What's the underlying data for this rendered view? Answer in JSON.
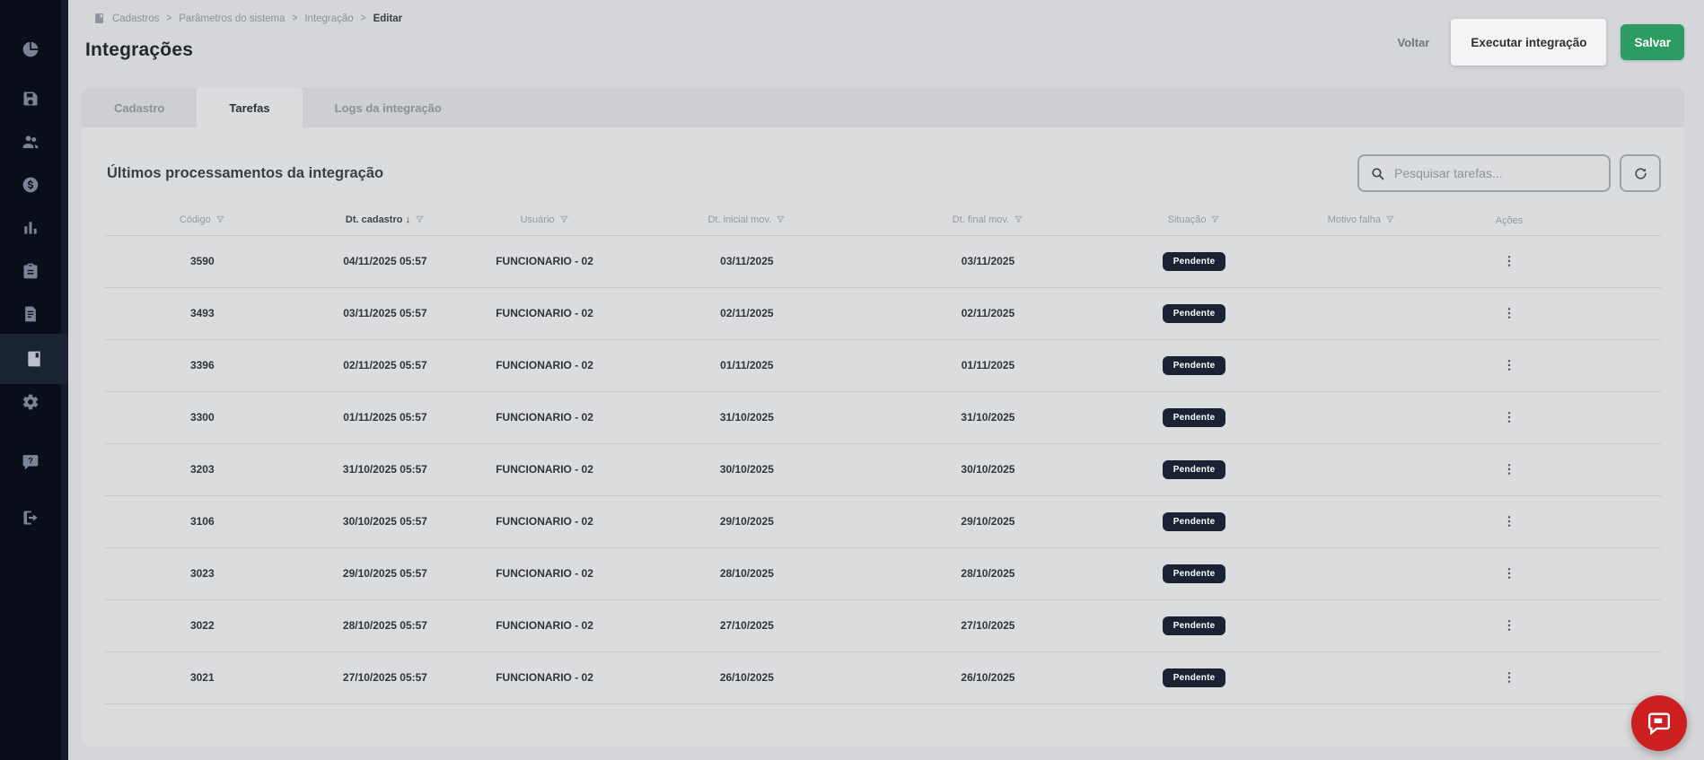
{
  "colors": {
    "sidebar_bg": "#0a0e18",
    "sidebar_active_bg": "#1a2334",
    "page_bg": "#d5d6d9",
    "strip_bg": "#cdcfd3",
    "card_bg": "#dbdcdd",
    "badge_bg": "#1b2233",
    "save_green": "#2c9c62",
    "fab_red": "#cc1f1f"
  },
  "sidebar": {
    "items": [
      {
        "icon": "pie-chart-icon",
        "active": false
      },
      {
        "icon": "save-icon",
        "active": false
      },
      {
        "icon": "users-icon",
        "active": false
      },
      {
        "icon": "dollar-icon",
        "active": false
      },
      {
        "icon": "bar-chart-icon",
        "active": false
      },
      {
        "icon": "clipboard-icon",
        "active": false
      },
      {
        "icon": "document-icon",
        "active": false
      },
      {
        "icon": "book-icon",
        "active": true
      },
      {
        "icon": "gear-icon",
        "active": false
      },
      {
        "icon": "help-icon",
        "active": false
      },
      {
        "icon": "logout-icon",
        "active": false
      }
    ]
  },
  "breadcrumb": {
    "items": [
      "Cadastros",
      "Parâmetros do sistema",
      "Integração",
      "Editar"
    ]
  },
  "header": {
    "title": "Integrações",
    "back_label": "Voltar",
    "run_label": "Executar integração",
    "save_label": "Salvar"
  },
  "tabs": [
    {
      "label": "Cadastro",
      "active": false
    },
    {
      "label": "Tarefas",
      "active": true
    },
    {
      "label": "Logs da integração",
      "active": false
    }
  ],
  "panel": {
    "title": "Últimos processamentos da integração",
    "search_placeholder": "Pesquisar tarefas..."
  },
  "table": {
    "columns": [
      {
        "label": "Código",
        "filter": true,
        "sorted": ""
      },
      {
        "label": "Dt. cadastro",
        "filter": true,
        "sorted": "desc"
      },
      {
        "label": "Usuário",
        "filter": true,
        "sorted": ""
      },
      {
        "label": "Dt. inicial mov.",
        "filter": true,
        "sorted": ""
      },
      {
        "label": "Dt. final mov.",
        "filter": true,
        "sorted": ""
      },
      {
        "label": "Situação",
        "filter": true,
        "sorted": ""
      },
      {
        "label": "Motivo falha",
        "filter": true,
        "sorted": ""
      },
      {
        "label": "Ações",
        "filter": false,
        "sorted": ""
      }
    ],
    "rows": [
      {
        "codigo": "3590",
        "dt_cadastro": "04/11/2025 05:57",
        "usuario": "FUNCIONARIO - 02",
        "dt_inicial_mov": "03/11/2025",
        "dt_final_mov": "03/11/2025",
        "situacao": "Pendente",
        "motivo_falha": ""
      },
      {
        "codigo": "3493",
        "dt_cadastro": "03/11/2025 05:57",
        "usuario": "FUNCIONARIO - 02",
        "dt_inicial_mov": "02/11/2025",
        "dt_final_mov": "02/11/2025",
        "situacao": "Pendente",
        "motivo_falha": ""
      },
      {
        "codigo": "3396",
        "dt_cadastro": "02/11/2025 05:57",
        "usuario": "FUNCIONARIO - 02",
        "dt_inicial_mov": "01/11/2025",
        "dt_final_mov": "01/11/2025",
        "situacao": "Pendente",
        "motivo_falha": ""
      },
      {
        "codigo": "3300",
        "dt_cadastro": "01/11/2025 05:57",
        "usuario": "FUNCIONARIO - 02",
        "dt_inicial_mov": "31/10/2025",
        "dt_final_mov": "31/10/2025",
        "situacao": "Pendente",
        "motivo_falha": ""
      },
      {
        "codigo": "3203",
        "dt_cadastro": "31/10/2025 05:57",
        "usuario": "FUNCIONARIO - 02",
        "dt_inicial_mov": "30/10/2025",
        "dt_final_mov": "30/10/2025",
        "situacao": "Pendente",
        "motivo_falha": ""
      },
      {
        "codigo": "3106",
        "dt_cadastro": "30/10/2025 05:57",
        "usuario": "FUNCIONARIO - 02",
        "dt_inicial_mov": "29/10/2025",
        "dt_final_mov": "29/10/2025",
        "situacao": "Pendente",
        "motivo_falha": ""
      },
      {
        "codigo": "3023",
        "dt_cadastro": "29/10/2025 05:57",
        "usuario": "FUNCIONARIO - 02",
        "dt_inicial_mov": "28/10/2025",
        "dt_final_mov": "28/10/2025",
        "situacao": "Pendente",
        "motivo_falha": ""
      },
      {
        "codigo": "3022",
        "dt_cadastro": "28/10/2025 05:57",
        "usuario": "FUNCIONARIO - 02",
        "dt_inicial_mov": "27/10/2025",
        "dt_final_mov": "27/10/2025",
        "situacao": "Pendente",
        "motivo_falha": ""
      },
      {
        "codigo": "3021",
        "dt_cadastro": "27/10/2025 05:57",
        "usuario": "FUNCIONARIO - 02",
        "dt_inicial_mov": "26/10/2025",
        "dt_final_mov": "26/10/2025",
        "situacao": "Pendente",
        "motivo_falha": ""
      }
    ]
  },
  "fab": {
    "icon": "chat-icon"
  }
}
